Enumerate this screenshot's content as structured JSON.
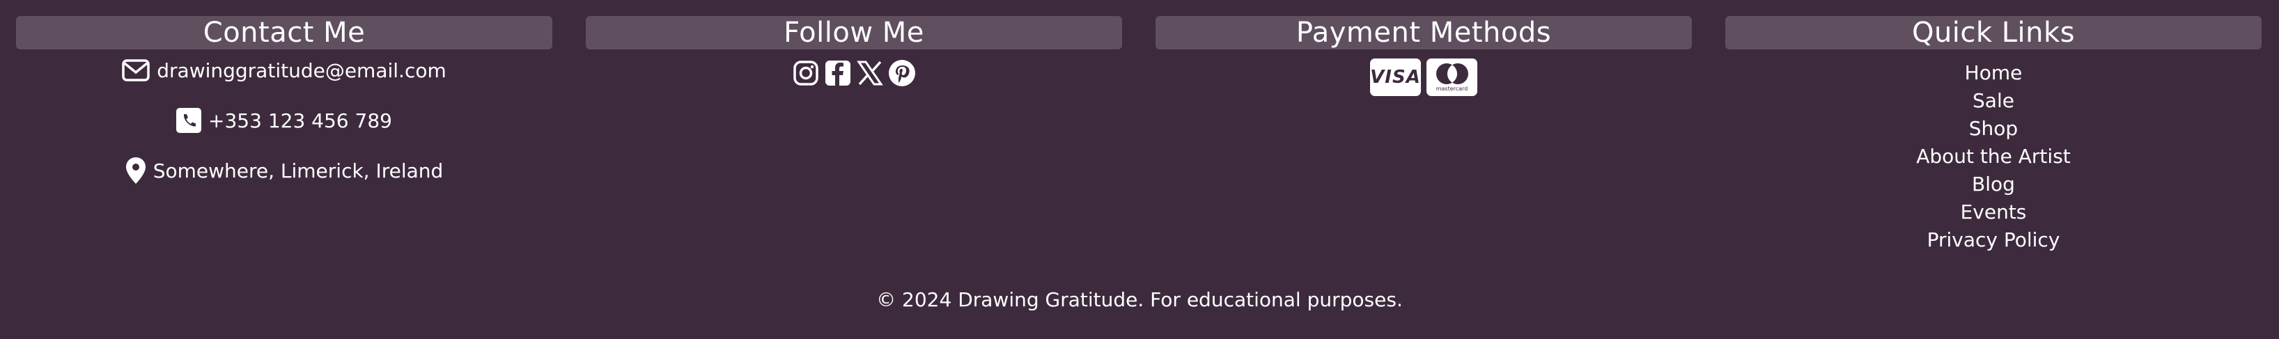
{
  "contact": {
    "heading": "Contact Me",
    "email": "drawinggratitude@email.com",
    "phone": "+353 123 456 789",
    "address": "Somewhere, Limerick, Ireland",
    "icons": [
      "envelope-icon",
      "phone-icon",
      "map-pin-icon"
    ]
  },
  "follow": {
    "heading": "Follow Me",
    "icons": [
      "instagram-icon",
      "facebook-icon",
      "x-icon",
      "pinterest-icon"
    ]
  },
  "payment": {
    "heading": "Payment Methods",
    "visa_label": "VISA",
    "mastercard_label": "mastercard"
  },
  "quick_links": {
    "heading": "Quick Links",
    "items": [
      "Home",
      "Sale",
      "Shop",
      "About the Artist",
      "Blog",
      "Events",
      "Privacy Policy"
    ]
  },
  "copyright": "© 2024 Drawing Gratitude. For educational purposes.",
  "colors": {
    "background": "#3d2b3d",
    "header_bar": "#5f4f5f",
    "text": "#ffffff"
  }
}
